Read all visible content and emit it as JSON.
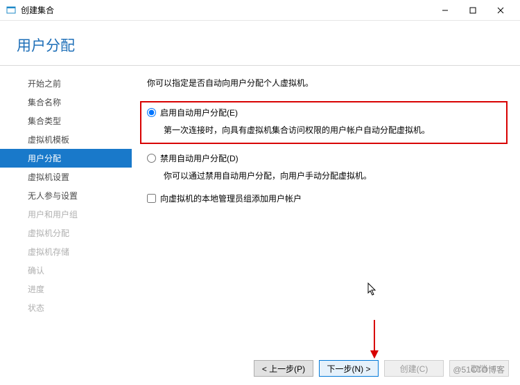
{
  "window": {
    "title": "创建集合"
  },
  "header": {
    "page_title": "用户分配"
  },
  "sidebar": {
    "items": [
      {
        "label": "开始之前",
        "disabled": false
      },
      {
        "label": "集合名称",
        "disabled": false
      },
      {
        "label": "集合类型",
        "disabled": false
      },
      {
        "label": "虚拟机模板",
        "disabled": false
      },
      {
        "label": "用户分配",
        "disabled": false,
        "active": true
      },
      {
        "label": "虚拟机设置",
        "disabled": false
      },
      {
        "label": "无人参与设置",
        "disabled": false
      },
      {
        "label": "用户和用户组",
        "disabled": true
      },
      {
        "label": "虚拟机分配",
        "disabled": true
      },
      {
        "label": "虚拟机存储",
        "disabled": true
      },
      {
        "label": "确认",
        "disabled": true
      },
      {
        "label": "进度",
        "disabled": true
      },
      {
        "label": "状态",
        "disabled": true
      }
    ]
  },
  "main": {
    "intro": "你可以指定是否自动向用户分配个人虚拟机。",
    "option_enable": {
      "label": "启用自动用户分配(E)",
      "desc": "第一次连接时，向具有虚拟机集合访问权限的用户帐户自动分配虚拟机。"
    },
    "option_disable": {
      "label": "禁用自动用户分配(D)",
      "desc": "你可以通过禁用自动用户分配，向用户手动分配虚拟机。"
    },
    "checkbox_admin": {
      "label": "向虚拟机的本地管理员组添加用户帐户"
    }
  },
  "footer": {
    "prev": "< 上一步(P)",
    "next": "下一步(N) >",
    "create": "创建(C)",
    "cancel": "取消"
  },
  "watermark": "@51CTO博客"
}
